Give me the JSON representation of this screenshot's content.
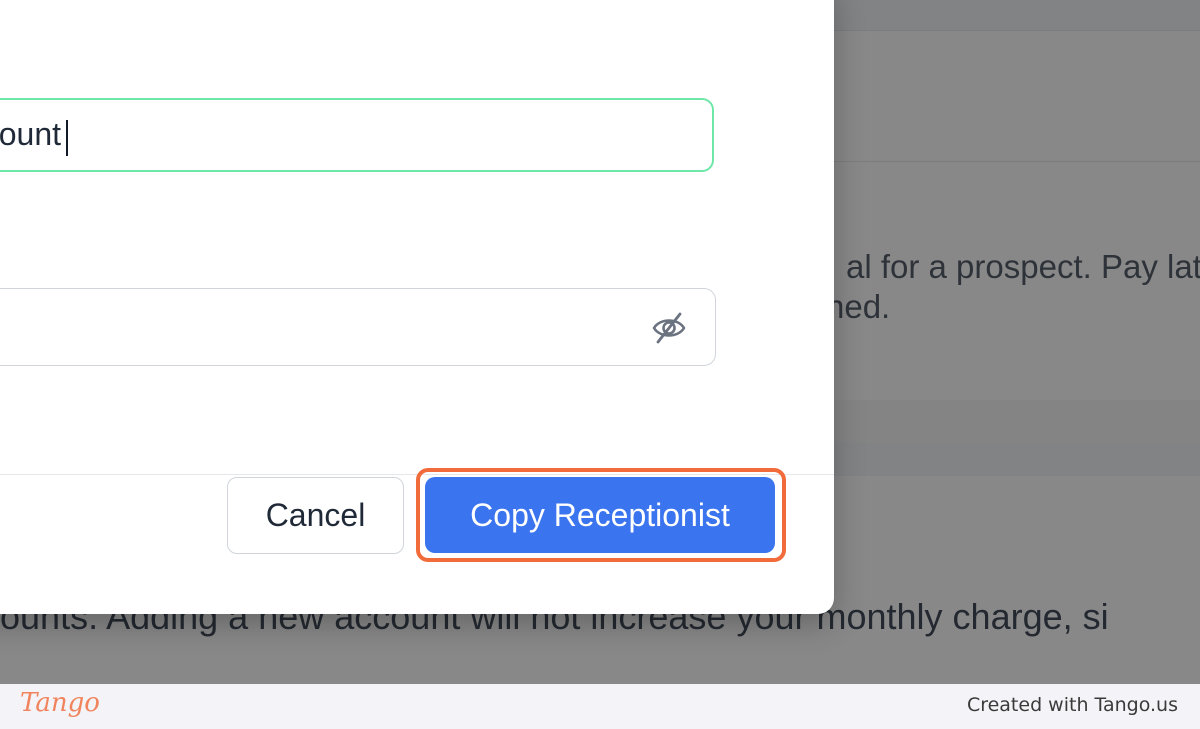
{
  "background": {
    "line1": "al for a prospect. Pay lat",
    "line2": "ned.",
    "line3": "ounts. Adding a new account will not increase your monthly charge, si"
  },
  "modal": {
    "name_field_value": "ount",
    "password_field_icon": "eye-slash-icon",
    "cancel_label": "Cancel",
    "primary_label": "Copy Receptionist",
    "colors": {
      "primary": "#3b74ef",
      "focus_border": "#6ee7a8",
      "highlight": "#f26b3a"
    }
  },
  "footer": {
    "logo": "Tango",
    "credit": "Created with Tango.us"
  }
}
